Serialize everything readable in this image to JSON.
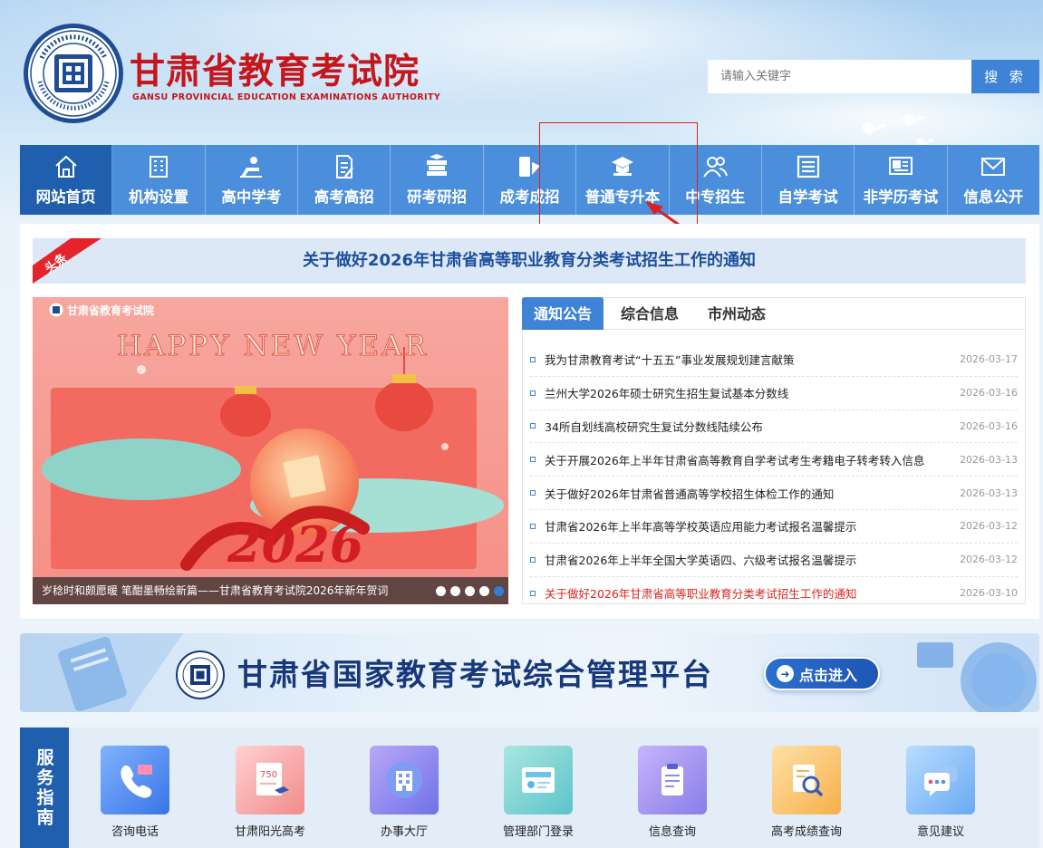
{
  "header": {
    "title": "甘肃省教育考试院",
    "subtitle": "GANSU PROVINCIAL EDUCATION EXAMINATIONS AUTHORITY"
  },
  "search": {
    "placeholder": "请输入关键字",
    "button_label": "搜 索"
  },
  "nav": [
    {
      "label": "网站首页",
      "icon": "home-icon",
      "active": true
    },
    {
      "label": "机构设置",
      "icon": "building-icon"
    },
    {
      "label": "高中学考",
      "icon": "student-desk-icon"
    },
    {
      "label": "高考高招",
      "icon": "exam-paper-icon"
    },
    {
      "label": "研考研招",
      "icon": "books-icon"
    },
    {
      "label": "成考成招",
      "icon": "id-card-icon"
    },
    {
      "label": "普通专升本",
      "icon": "graduation-cap-icon",
      "highlighted": true
    },
    {
      "label": "中专招生",
      "icon": "users-icon"
    },
    {
      "label": "自学考试",
      "icon": "list-icon"
    },
    {
      "label": "非学历考试",
      "icon": "certificate-icon"
    },
    {
      "label": "信息公开",
      "icon": "mail-icon"
    }
  ],
  "headline": {
    "tag": "头条",
    "text": "关于做好2026年甘肃省高等职业教育分类考试招生工作的通知"
  },
  "carousel": {
    "brand": "甘肃省教育考试院",
    "image_text": "HAPPY NEW YEAR",
    "year": "2026",
    "caption": "岁稔时和颇愿暖 笔酣墨畅绘新篇——甘肃省教育考试院2026年新年贺词",
    "slide_count": 5,
    "active_index": 4
  },
  "news": {
    "tabs": [
      "通知公告",
      "综合信息",
      "市州动态"
    ],
    "active_tab": 0,
    "items": [
      {
        "title": "我为甘肃教育考试“十五五”事业发展规划建言献策",
        "date": "2026-03-17"
      },
      {
        "title": "兰州大学2026年硕士研究生招生复试基本分数线",
        "date": "2026-03-16"
      },
      {
        "title": "34所自划线高校研究生复试分数线陆续公布",
        "date": "2026-03-16"
      },
      {
        "title": "关于开展2026年上半年甘肃省高等教育自学考试考生考籍电子转考转入信息",
        "date": "2026-03-13"
      },
      {
        "title": "关于做好2026年甘肃省普通高等学校招生体检工作的通知",
        "date": "2026-03-13"
      },
      {
        "title": "甘肃省2026年上半年高等学校英语应用能力考试报名温馨提示",
        "date": "2026-03-12"
      },
      {
        "title": "甘肃省2026年上半年全国大学英语四、六级考试报名温馨提示",
        "date": "2026-03-12"
      },
      {
        "title": "关于做好2026年甘肃省高等职业教育分类考试招生工作的通知",
        "date": "2026-03-10",
        "highlight": true
      }
    ]
  },
  "banner": {
    "title": "甘肃省国家教育考试综合管理平台",
    "button_label": "点击进入"
  },
  "service": {
    "title": "服务指南",
    "items": [
      {
        "label": "咨询电话",
        "icon": "phone-icon"
      },
      {
        "label": "甘肃阳光高考",
        "icon": "score-paper-icon",
        "badge": "750"
      },
      {
        "label": "办事大厅",
        "icon": "office-building-icon"
      },
      {
        "label": "管理部门登录",
        "icon": "login-card-icon"
      },
      {
        "label": "信息查询",
        "icon": "clipboard-icon"
      },
      {
        "label": "高考成绩查询",
        "icon": "search-document-icon"
      },
      {
        "label": "意见建议",
        "icon": "chat-bubble-icon"
      }
    ]
  },
  "colors": {
    "brand_red": "#c4161c",
    "nav_blue": "#4a8edc",
    "nav_active": "#1f5fae",
    "accent": "#3e83d6",
    "highlight_red": "#d9251c"
  }
}
